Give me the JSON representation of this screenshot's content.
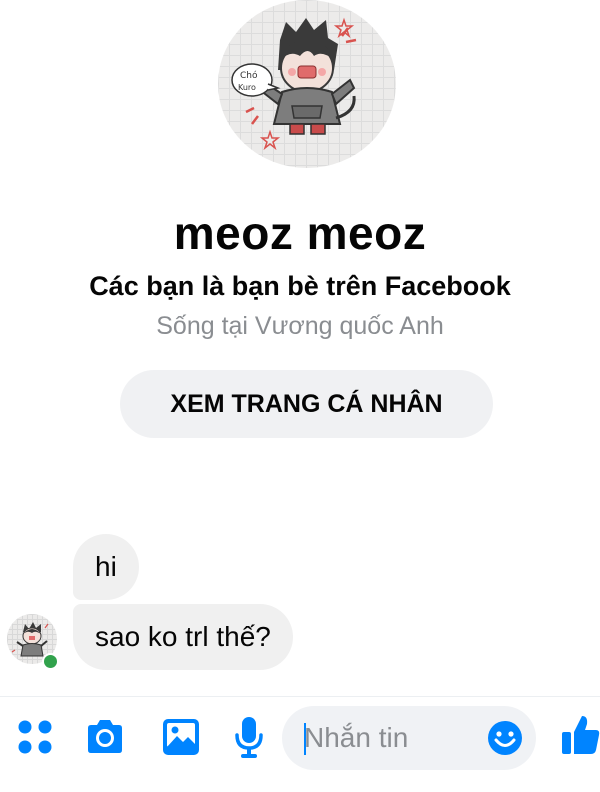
{
  "profile": {
    "name": "meoz meoz",
    "friend_status": "Các bạn là bạn bè trên Facebook",
    "location": "Sống tại Vương quốc Anh",
    "view_profile_label": "XEM TRANG CÁ NHÂN",
    "photo_caption": "Chó Kuro"
  },
  "messages": [
    {
      "text": "hi",
      "from": "meoz meoz"
    },
    {
      "text": "sao ko trl thế?",
      "from": "meoz meoz"
    }
  ],
  "sender": {
    "online": true
  },
  "composer": {
    "placeholder": "Nhắn tin",
    "value": "",
    "icons": [
      "apps-icon",
      "camera-icon",
      "gallery-icon",
      "microphone-icon",
      "emoji-icon",
      "thumbs-up-icon"
    ]
  },
  "colors": {
    "accent": "#0084ff",
    "online": "#31a24c",
    "bubble": "#f0f0f0",
    "secondary_text": "#8a8d91"
  }
}
